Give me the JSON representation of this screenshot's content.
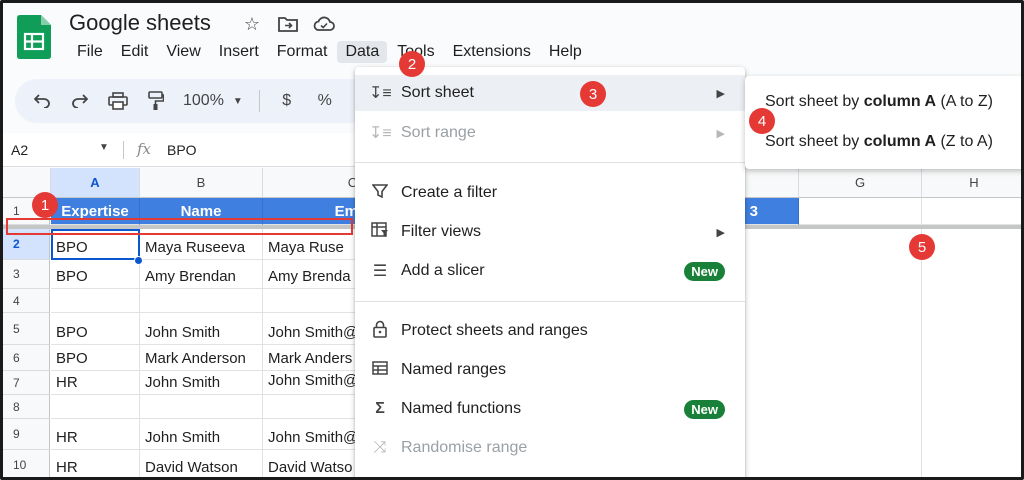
{
  "app": {
    "title": "Google sheets",
    "brand_color": "#0f9d58"
  },
  "menubar": [
    "File",
    "Edit",
    "View",
    "Insert",
    "Format",
    "Data",
    "Tools",
    "Extensions",
    "Help"
  ],
  "toolbar": {
    "zoom": "100%",
    "currency": "$",
    "percent": "%"
  },
  "formula_bar": {
    "cell_ref": "A2",
    "fx": "fx",
    "value": "BPO"
  },
  "grid": {
    "columns": [
      "A",
      "B",
      "C",
      "G",
      "H"
    ],
    "header_row": [
      "Expertise",
      "Name",
      "Emai",
      "3"
    ],
    "rows": [
      {
        "num": "1"
      },
      {
        "num": "2",
        "cells": [
          "BPO",
          "Maya Ruseeva",
          "Maya Ruse"
        ]
      },
      {
        "num": "3",
        "cells": [
          "BPO",
          "Amy Brendan",
          "Amy Brenda"
        ]
      },
      {
        "num": "4",
        "cells": [
          "",
          "",
          ""
        ]
      },
      {
        "num": "5",
        "cells": [
          "BPO",
          "John Smith",
          "John Smith@"
        ]
      },
      {
        "num": "6",
        "cells": [
          "BPO",
          "Mark Anderson",
          "Mark Anders"
        ]
      },
      {
        "num": "7",
        "cells": [
          "HR",
          "John Smith",
          "John Smith@"
        ]
      },
      {
        "num": "8",
        "cells": [
          "",
          "",
          ""
        ]
      },
      {
        "num": "9",
        "cells": [
          "HR",
          "John Smith",
          "John Smith@"
        ]
      },
      {
        "num": "10",
        "cells": [
          "HR",
          "David Watson",
          "David Watso"
        ]
      }
    ]
  },
  "data_menu": {
    "items": [
      {
        "label": "Sort sheet",
        "icon": "sort-icon"
      },
      {
        "label": "Sort range",
        "icon": "sort-icon"
      },
      {
        "label": "Create a filter",
        "icon": "filter-icon"
      },
      {
        "label": "Filter views",
        "icon": "filter-views-icon"
      },
      {
        "label": "Add a slicer",
        "icon": "slicer-icon",
        "badge": "New"
      },
      {
        "label": "Protect sheets and ranges",
        "icon": "lock-icon"
      },
      {
        "label": "Named ranges",
        "icon": "named-ranges-icon"
      },
      {
        "label": "Named functions",
        "icon": "sigma-icon",
        "badge": "New"
      },
      {
        "label": "Randomise range",
        "icon": "shuffle-icon"
      }
    ]
  },
  "submenu": {
    "item1": {
      "prefix": "Sort sheet by ",
      "bold": "column A",
      "suffix": " (A to Z)"
    },
    "item2": {
      "prefix": "Sort sheet by ",
      "bold": "column A",
      "suffix": " (Z to A)"
    }
  },
  "annotations": [
    "1",
    "2",
    "3",
    "4",
    "5"
  ],
  "colors": {
    "annotation": "#e53935",
    "header_fill": "#3f7fe0",
    "new_badge": "#188038",
    "selection": "#0b57d0"
  }
}
